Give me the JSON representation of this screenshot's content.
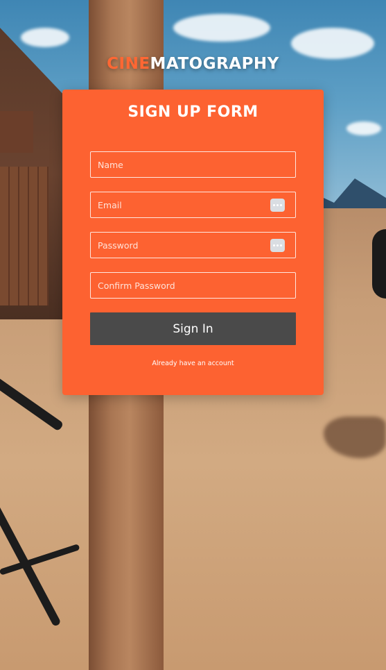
{
  "logo": {
    "part1": "CINE",
    "part2": "MATOGRAPHY"
  },
  "form": {
    "title": "SIGN UP FORM",
    "fields": [
      {
        "placeholder": "Name",
        "value": ""
      },
      {
        "placeholder": "Email",
        "value": ""
      },
      {
        "placeholder": "Password",
        "value": ""
      },
      {
        "placeholder": "Confirm Password",
        "value": ""
      }
    ],
    "submit_label": "Sign In",
    "account_link": "Already have an account"
  },
  "colors": {
    "accent": "#fd6231",
    "button": "#4a4a4a",
    "text": "#ffffff"
  },
  "icons": {
    "email_field": "password-manager-key-icon",
    "password_field": "password-manager-key-icon"
  }
}
